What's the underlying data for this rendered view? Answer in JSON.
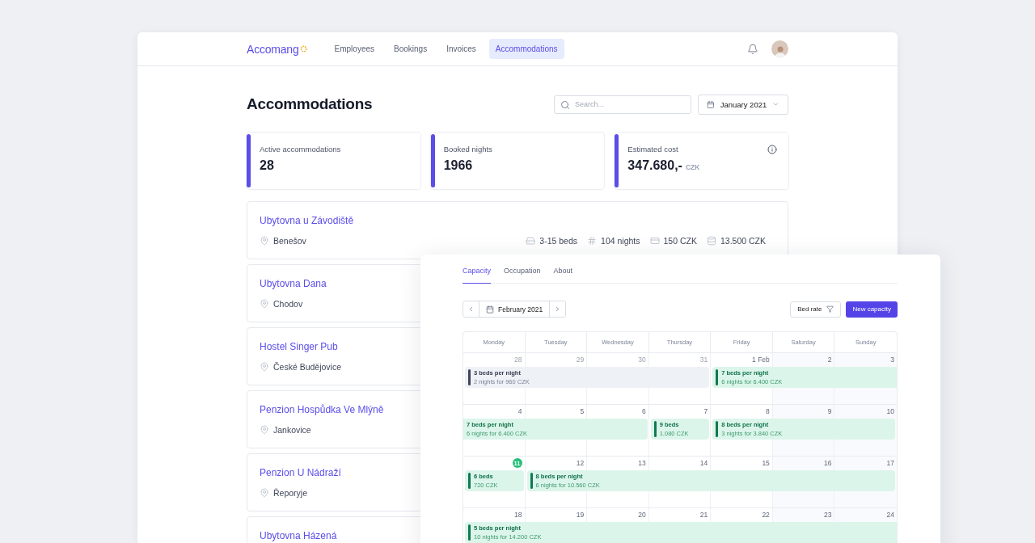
{
  "brand": "Accomang",
  "nav": [
    {
      "label": "Employees",
      "selected": false
    },
    {
      "label": "Bookings",
      "selected": false
    },
    {
      "label": "Invoices",
      "selected": false
    },
    {
      "label": "Accommodations",
      "selected": true
    }
  ],
  "page_title": "Accommodations",
  "search": {
    "placeholder": "Search..."
  },
  "month_picker": {
    "value": "January 2021"
  },
  "stats": [
    {
      "label": "Active accommodations",
      "value": "28",
      "info": false
    },
    {
      "label": "Booked nights",
      "value": "1966",
      "info": false
    },
    {
      "label": "Estimated cost",
      "value": "347.680,-",
      "unit": "CZK",
      "info": true
    }
  ],
  "accommodations": [
    {
      "name": "Ubytovna u Závodiště",
      "location": "Benešov",
      "details": [
        {
          "kind": "beds",
          "text": "3-15 beds"
        },
        {
          "kind": "nights",
          "text": "104 nights"
        },
        {
          "kind": "rate",
          "text": "150 CZK"
        },
        {
          "kind": "total",
          "text": "13.500 CZK"
        }
      ]
    },
    {
      "name": "Ubytovna Dana",
      "location": "Chodov"
    },
    {
      "name": "Hostel Singer Pub",
      "location": "České Budějovice"
    },
    {
      "name": "Penzion Hospůdka Ve Mlýně",
      "location": "Jankovice"
    },
    {
      "name": "Penzion U Nádraží",
      "location": "Řeporyje"
    },
    {
      "name": "Ubytovna Házená"
    }
  ],
  "detail": {
    "tabs": [
      {
        "label": "Capacity",
        "selected": true
      },
      {
        "label": "Occupation",
        "selected": false
      },
      {
        "label": "About",
        "selected": false
      }
    ],
    "month": "February 2021",
    "filter_button": "Bed rate",
    "new_button": "New capacity",
    "weekdays": [
      "Monday",
      "Tuesday",
      "Wednesday",
      "Thursday",
      "Friday",
      "Saturday",
      "Sunday"
    ],
    "weeks": [
      {
        "days": [
          {
            "label": "28",
            "outside": true,
            "today": false
          },
          {
            "label": "29",
            "outside": true,
            "today": false
          },
          {
            "label": "30",
            "outside": true,
            "today": false
          },
          {
            "label": "31",
            "outside": true,
            "today": false
          },
          {
            "label": "1 Feb",
            "outside": false,
            "today": false
          },
          {
            "label": "2",
            "outside": false,
            "today": false
          },
          {
            "label": "3",
            "outside": false,
            "today": false
          }
        ],
        "events": [
          {
            "past": true,
            "continued": false,
            "continues": false,
            "title": "3 beds per night",
            "detail": "2 nights for 960 CZK"
          },
          {
            "past": false,
            "continued": false,
            "continues": true,
            "title": "7 beds per night",
            "detail": "6 nights for 6.400 CZK"
          }
        ]
      },
      {
        "days": [
          {
            "label": "4",
            "outside": false,
            "today": false
          },
          {
            "label": "5",
            "outside": false,
            "today": false
          },
          {
            "label": "6",
            "outside": false,
            "today": false
          },
          {
            "label": "7",
            "outside": false,
            "today": false
          },
          {
            "label": "8",
            "outside": false,
            "today": false
          },
          {
            "label": "9",
            "outside": false,
            "today": false
          },
          {
            "label": "10",
            "outside": false,
            "today": false
          }
        ],
        "events": [
          {
            "past": false,
            "continued": true,
            "continues": false,
            "title": "7 beds per night",
            "detail": "6 nights for 6.400 CZK"
          },
          {
            "past": false,
            "continued": false,
            "continues": false,
            "title": "9 beds",
            "detail": "1.080 CZK"
          },
          {
            "past": false,
            "continued": false,
            "continues": false,
            "title": "8 beds per night",
            "detail": "3 nights for 3.840 CZK"
          }
        ]
      },
      {
        "days": [
          {
            "label": "11",
            "outside": false,
            "today": true
          },
          {
            "label": "12",
            "outside": false,
            "today": false
          },
          {
            "label": "13",
            "outside": false,
            "today": false
          },
          {
            "label": "14",
            "outside": false,
            "today": false
          },
          {
            "label": "15",
            "outside": false,
            "today": false
          },
          {
            "label": "16",
            "outside": false,
            "today": false
          },
          {
            "label": "17",
            "outside": false,
            "today": false
          }
        ],
        "events": [
          {
            "past": false,
            "continued": false,
            "continues": false,
            "title": "6 beds",
            "detail": "720 CZK"
          },
          {
            "past": false,
            "continued": false,
            "continues": false,
            "title": "8 beds per night",
            "detail": "6 nights for 10.560 CZK"
          }
        ]
      },
      {
        "days": [
          {
            "label": "18",
            "outside": false,
            "today": false
          },
          {
            "label": "19",
            "outside": false,
            "today": false
          },
          {
            "label": "20",
            "outside": false,
            "today": false
          },
          {
            "label": "21",
            "outside": false,
            "today": false
          },
          {
            "label": "22",
            "outside": false,
            "today": false
          },
          {
            "label": "23",
            "outside": false,
            "today": false
          },
          {
            "label": "24",
            "outside": false,
            "today": false
          }
        ],
        "events": [
          {
            "past": false,
            "continued": false,
            "continues": true,
            "title": "5 beds per night",
            "detail": "10 nights for 14.200 CZK"
          }
        ]
      }
    ]
  }
}
